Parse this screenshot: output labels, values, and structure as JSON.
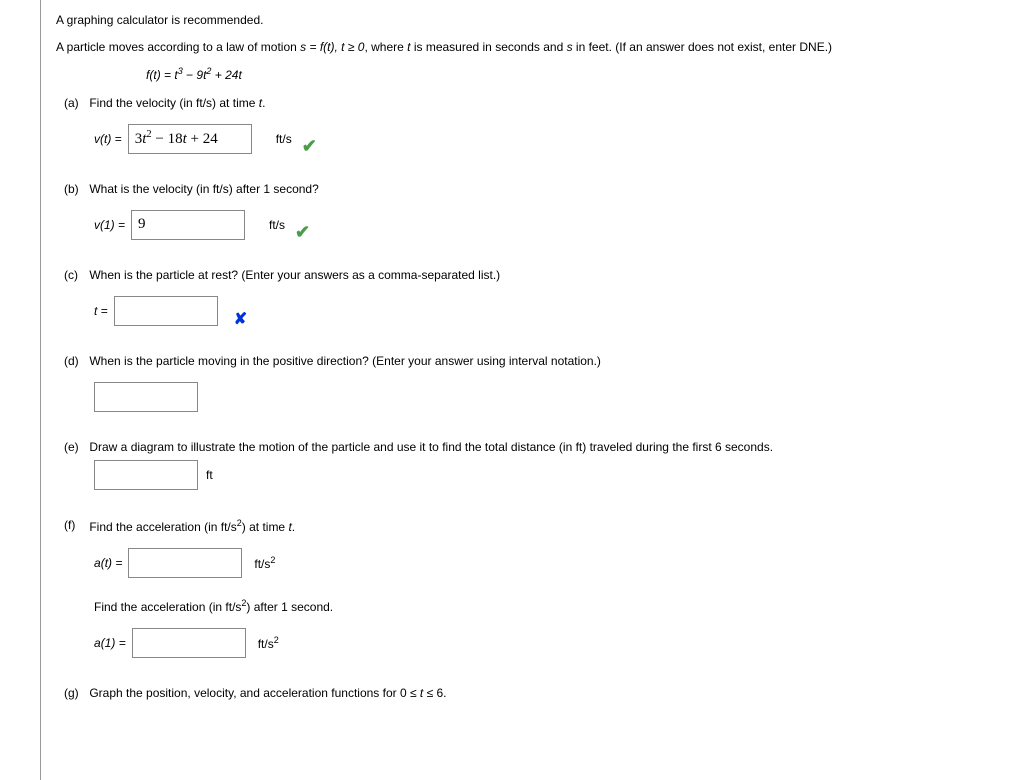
{
  "intro": {
    "line1": "A graphing calculator is recommended.",
    "line2_prefix": "A particle moves according to a law of motion ",
    "line2_formula": "s = f(t), t ≥ 0",
    "line2_suffix": ", where t is measured in seconds and s in feet. (If an answer does not exist, enter DNE.)",
    "formula_lhs": "f(t) = ",
    "formula_rhs": "t³ − 9t² + 24t"
  },
  "parts": {
    "a": {
      "label": "(a)",
      "question": "Find the velocity (in ft/s) at time ",
      "question_var": "t",
      "question_end": ".",
      "prefix": "v(t) = ",
      "value": "3t² − 18t + 24",
      "unit": "ft/s",
      "status": "correct"
    },
    "b": {
      "label": "(b)",
      "question": "What is the velocity (in ft/s) after 1 second?",
      "prefix": "v(1) = ",
      "value": "9",
      "unit": "ft/s",
      "status": "correct"
    },
    "c": {
      "label": "(c)",
      "question": "When is the particle at rest? (Enter your answers as a comma-separated list.)",
      "prefix": "t = ",
      "value": "",
      "status": "incorrect"
    },
    "d": {
      "label": "(d)",
      "question": "When is the particle moving in the positive direction? (Enter your answer using interval notation.)",
      "value": ""
    },
    "e": {
      "label": "(e)",
      "question": "Draw a diagram to illustrate the motion of the particle and use it to find the total distance (in ft) traveled during the first 6 seconds.",
      "value": "",
      "unit": "ft"
    },
    "f": {
      "label": "(f)",
      "question": "Find the acceleration (in ft/s²) at time ",
      "question_var": "t",
      "question_end": ".",
      "prefix": "a(t) = ",
      "value": "",
      "unit": "ft/s²",
      "sub_question": "Find the acceleration (in ft/s²) after 1 second.",
      "sub_prefix": "a(1) = ",
      "sub_value": "",
      "sub_unit": "ft/s²"
    },
    "g": {
      "label": "(g)",
      "question": "Graph the position, velocity, and acceleration functions for 0 ≤ t ≤ 6."
    }
  }
}
